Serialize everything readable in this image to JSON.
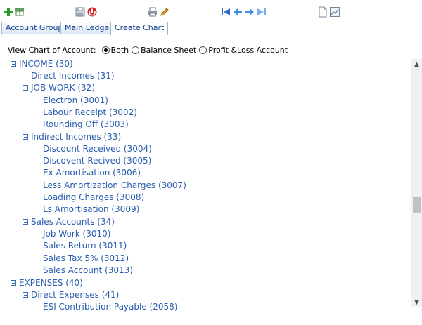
{
  "toolbar": {
    "buttons": [
      {
        "icon": "add-icon"
      },
      {
        "icon": "table-edit-icon"
      },
      {
        "icon": "save-icon"
      },
      {
        "icon": "delete-icon"
      },
      {
        "icon": "print-icon"
      },
      {
        "icon": "edit-pencil-icon"
      },
      {
        "icon": "first-record-icon"
      },
      {
        "icon": "previous-record-icon"
      },
      {
        "icon": "next-record-icon"
      },
      {
        "icon": "last-record-icon"
      },
      {
        "icon": "new-document-icon"
      },
      {
        "icon": "chart-image-icon"
      }
    ]
  },
  "tabs": [
    {
      "label": "Account Group"
    },
    {
      "label": "Main Ledger"
    },
    {
      "label": "Create Chart"
    }
  ],
  "active_tab": "Create Chart",
  "view": {
    "label": "View Chart of Account:",
    "options": [
      {
        "label": "Both",
        "checked": true
      },
      {
        "label": "Balance Sheet",
        "checked": false
      },
      {
        "label": "Profit &Loss Account",
        "checked": false
      }
    ]
  },
  "tree": [
    {
      "label": "INCOME (30)",
      "level": 0,
      "toggle": true
    },
    {
      "label": "Direct Incomes (31)",
      "level": 1,
      "toggle": false
    },
    {
      "label": "JOB WORK (32)",
      "level": 1,
      "toggle": true
    },
    {
      "label": "Electron (3001)",
      "level": 2,
      "toggle": false
    },
    {
      "label": "Labour Receipt (3002)",
      "level": 2,
      "toggle": false
    },
    {
      "label": "Rounding Off (3003)",
      "level": 2,
      "toggle": false
    },
    {
      "label": "Indirect Incomes (33)",
      "level": 1,
      "toggle": true
    },
    {
      "label": "Discount Received (3004)",
      "level": 2,
      "toggle": false
    },
    {
      "label": "Discovent Recived (3005)",
      "level": 2,
      "toggle": false
    },
    {
      "label": "Ex Amortisation (3006)",
      "level": 2,
      "toggle": false
    },
    {
      "label": "Less Amortization Charges (3007)",
      "level": 2,
      "toggle": false
    },
    {
      "label": "Loading Charges (3008)",
      "level": 2,
      "toggle": false
    },
    {
      "label": "Ls Amortisation (3009)",
      "level": 2,
      "toggle": false
    },
    {
      "label": "Sales Accounts (34)",
      "level": 1,
      "toggle": true
    },
    {
      "label": "Job Work (3010)",
      "level": 2,
      "toggle": false
    },
    {
      "label": "Sales Return (3011)",
      "level": 2,
      "toggle": false
    },
    {
      "label": "Sales Tax 5% (3012)",
      "level": 2,
      "toggle": false
    },
    {
      "label": "Sales Account (3013)",
      "level": 2,
      "toggle": false
    },
    {
      "label": "EXPENSES (40)",
      "level": 0,
      "toggle": true
    },
    {
      "label": "Direct Expenses (41)",
      "level": 1,
      "toggle": true
    },
    {
      "label": "ESI Contribution Payable (2058)",
      "level": 2,
      "toggle": false
    }
  ],
  "colors": {
    "link": "#2a5db0",
    "tab_border": "#9fb6cf",
    "tab_text": "#15428b"
  }
}
